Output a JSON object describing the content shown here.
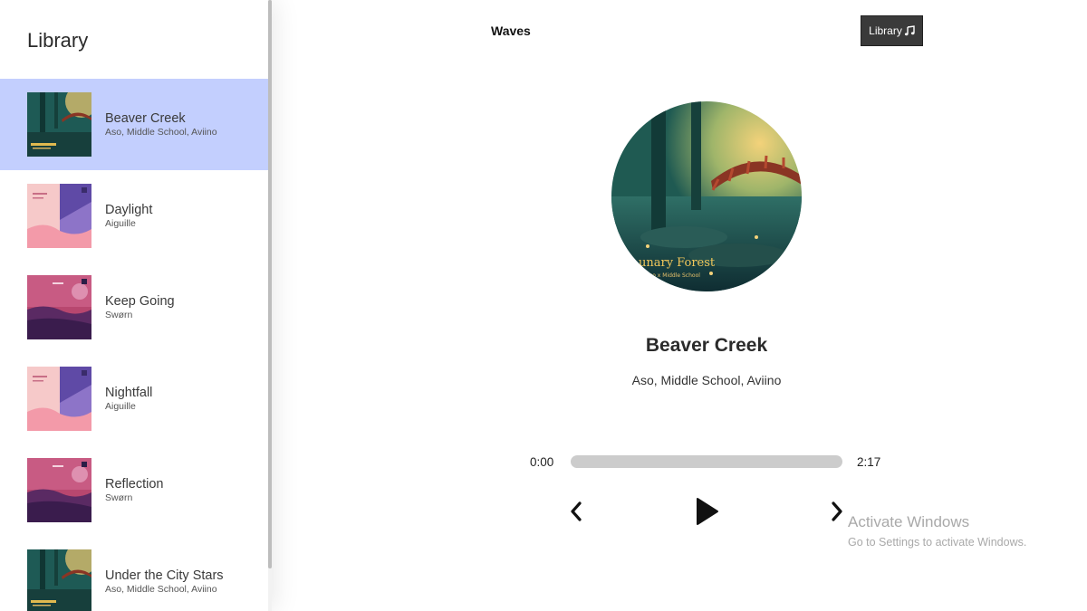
{
  "sidebar": {
    "title": "Library",
    "songs": [
      {
        "name": "Beaver Creek",
        "artist": "Aso, Middle School, Aviino",
        "cover": "forest-cover",
        "selected": true
      },
      {
        "name": "Daylight",
        "artist": "Aiguille",
        "cover": "pink-cover",
        "selected": false
      },
      {
        "name": "Keep Going",
        "artist": "Swørn",
        "cover": "magenta-cover",
        "selected": false
      },
      {
        "name": "Nightfall",
        "artist": "Aiguille",
        "cover": "pink-cover",
        "selected": false
      },
      {
        "name": "Reflection",
        "artist": "Swørn",
        "cover": "magenta-cover",
        "selected": false
      },
      {
        "name": "Under the City Stars",
        "artist": "Aso, Middle School, Aviino",
        "cover": "forest-cover",
        "selected": false
      }
    ]
  },
  "nav": {
    "brand": "Waves",
    "library_button": "Library",
    "library_icon": "music-note-icon"
  },
  "player": {
    "title": "Beaver Creek",
    "artist": "Aso, Middle School, Aviino",
    "artwork": "forest-cover",
    "current_time": "0:00",
    "duration": "2:17",
    "progress": 0,
    "controls": [
      "chevron-left-icon",
      "play-icon",
      "chevron-right-icon"
    ]
  },
  "watermark": {
    "title": "Activate Windows",
    "subtitle": "Go to Settings to activate Windows."
  },
  "colors": {
    "selected_row": "#c3cffe",
    "track": "#cccccc",
    "button_bg": "#3a3a3a"
  }
}
